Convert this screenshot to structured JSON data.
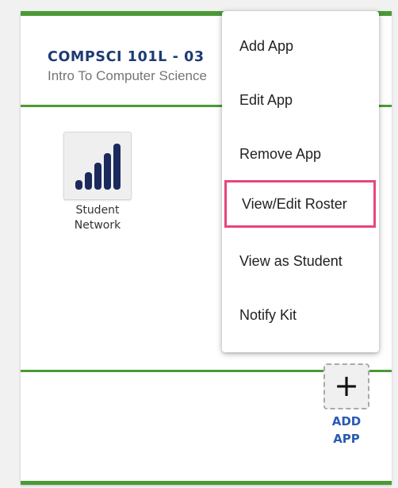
{
  "course": {
    "code": "COMPSCI 101L - 03",
    "title": "Intro To Computer Science"
  },
  "apps": [
    {
      "label": "Student Network",
      "icon": "signal-bars-icon"
    }
  ],
  "add_app": {
    "plus": "+",
    "label": "ADD APP"
  },
  "menu": {
    "items": [
      {
        "label": "Add App"
      },
      {
        "label": "Edit App"
      },
      {
        "label": "Remove App"
      },
      {
        "label": "View/Edit Roster",
        "highlighted": true
      },
      {
        "label": "View as Student"
      },
      {
        "label": "Notify Kit"
      }
    ]
  },
  "colors": {
    "accent_green": "#4a9a36",
    "course_code": "#1c3b73",
    "add_label": "#2a5bb3",
    "highlight_border": "#e6467a"
  }
}
